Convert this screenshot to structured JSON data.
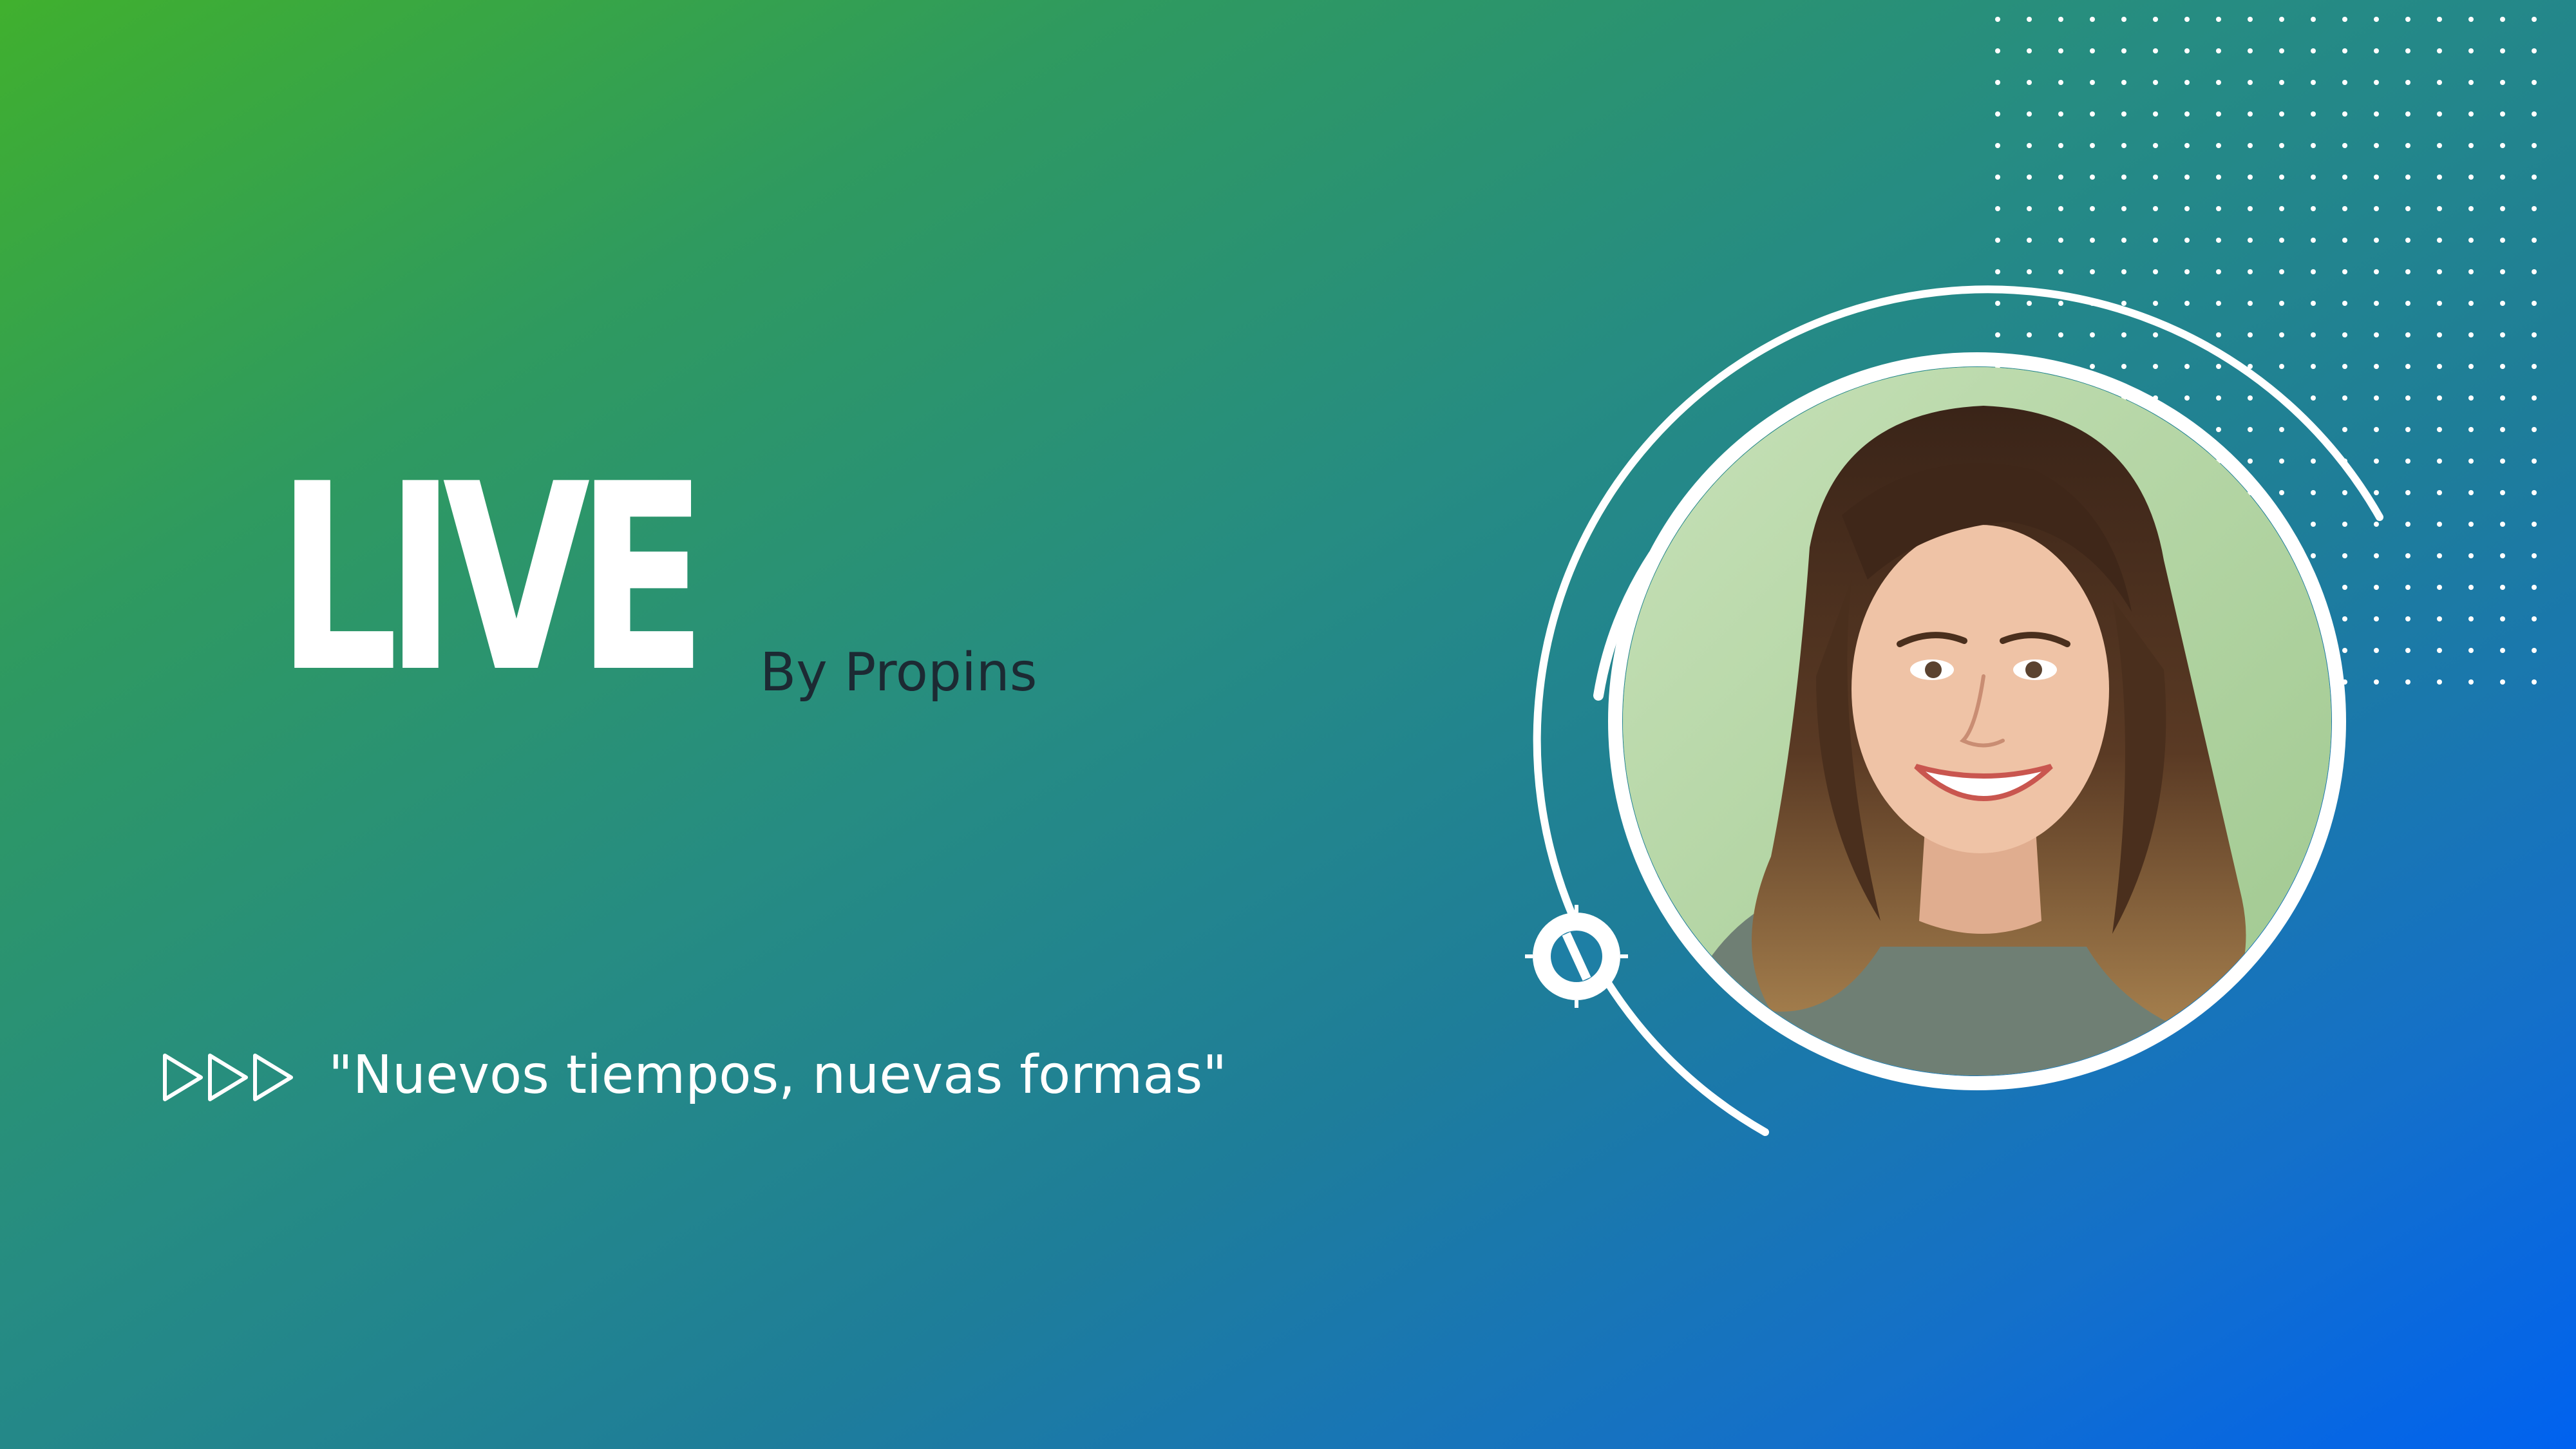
{
  "title": "LIVE",
  "byline": "By Propins",
  "tagline": "\"Nuevos tiempos, nuevas formas\"",
  "icons": {
    "arrows": "triple-triangle-arrows-icon",
    "circle_knob": "circle-knob-icon"
  },
  "colors": {
    "gradient_start": "#40b02e",
    "gradient_end": "#0062f0",
    "text_light": "#ffffff",
    "text_dark": "#1c2a33",
    "photo_background": "#b9d9ae"
  }
}
